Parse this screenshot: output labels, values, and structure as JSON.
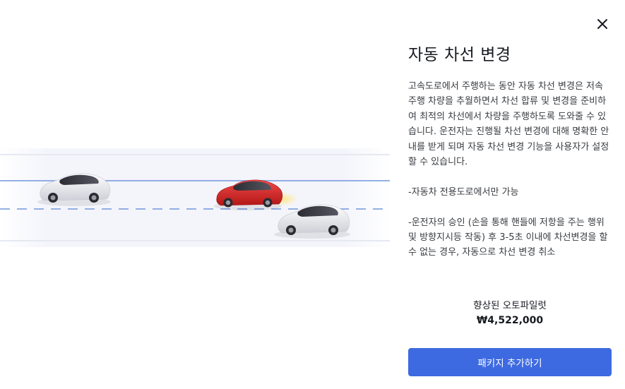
{
  "modal": {
    "close_icon": "close-icon",
    "title": "자동 차선 변경",
    "description": [
      "고속도로에서 주행하는 동안 자동 차선 변경은 저속 주행 차량을 추월하면서 차선 합류 및 변경을 준비하여 최적의 차선에서 차량을 주행하도록 도와줄 수 있습니다. 운전자는 진행될 차선 변경에 대해 명확한 안내를 받게 되며 자동 차선 변경 기능을 사용자가 설정할 수 있습니다.",
      "-자동차 전용도로에서만 가능",
      "-운전자의 승인 (손을 통해 핸들에 저항을 주는 행위 및 방향지시등 작동) 후 3-5초 이내에 차선변경을 할 수 없는 경우, 자동으로 차선 변경 취소"
    ],
    "package_name": "향상된 오토파일럿",
    "package_price": "₩4,522,000",
    "add_button_label": "패키지 추가하기"
  },
  "illustration": {
    "cars": [
      {
        "color": "#e8e8ee",
        "role": "left"
      },
      {
        "color": "#d42a2a",
        "role": "changing-lane"
      },
      {
        "color": "#ececf1",
        "role": "right"
      }
    ],
    "lane_line_color": "#5b86d8"
  },
  "colors": {
    "accent": "#3e6ae1",
    "title": "#171a20",
    "body_text": "#393c41"
  }
}
